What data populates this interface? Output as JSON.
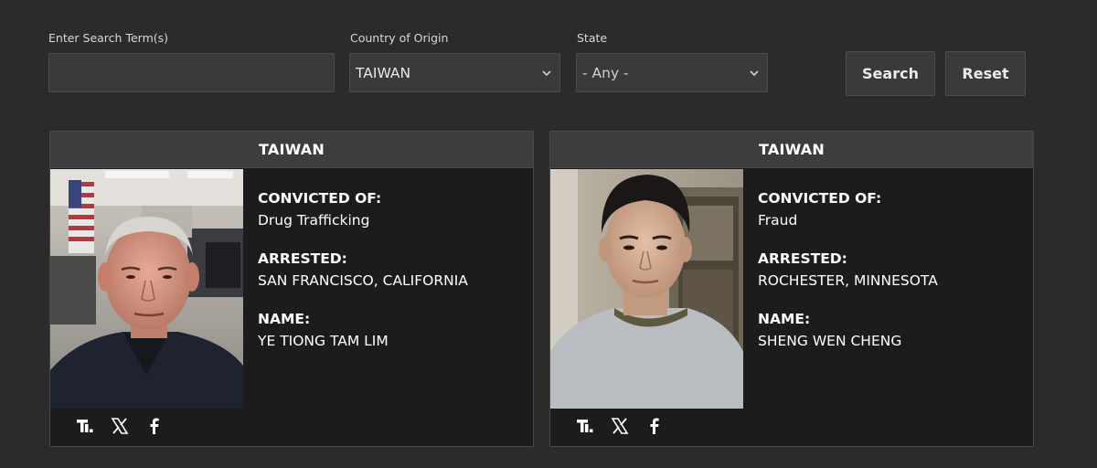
{
  "filters": {
    "search_label": "Enter Search Term(s)",
    "search_value": "",
    "country_label": "Country of Origin",
    "country_value": "TAIWAN",
    "state_label": "State",
    "state_value": "- Any -",
    "search_button": "Search",
    "reset_button": "Reset"
  },
  "cards": [
    {
      "header": "TAIWAN",
      "convicted_label": "CONVICTED OF:",
      "convicted": "Drug Trafficking",
      "arrested_label": "ARRESTED:",
      "arrested": "SAN FRANCISCO, CALIFORNIA",
      "name_label": "NAME:",
      "name": "YE TIONG TAM LIM"
    },
    {
      "header": "TAIWAN",
      "convicted_label": "CONVICTED OF:",
      "convicted": "Fraud",
      "arrested_label": "ARRESTED:",
      "arrested": "ROCHESTER, MINNESOTA",
      "name_label": "NAME:",
      "name": "SHENG WEN CHENG"
    }
  ],
  "icons": [
    "truth-social-icon",
    "x-icon",
    "facebook-icon"
  ],
  "colors": {
    "page_bg": "#2b2b2b",
    "card_bg": "#1c1c1c",
    "header_bg": "#3d3d3d",
    "control_bg": "#3a3a3a"
  }
}
